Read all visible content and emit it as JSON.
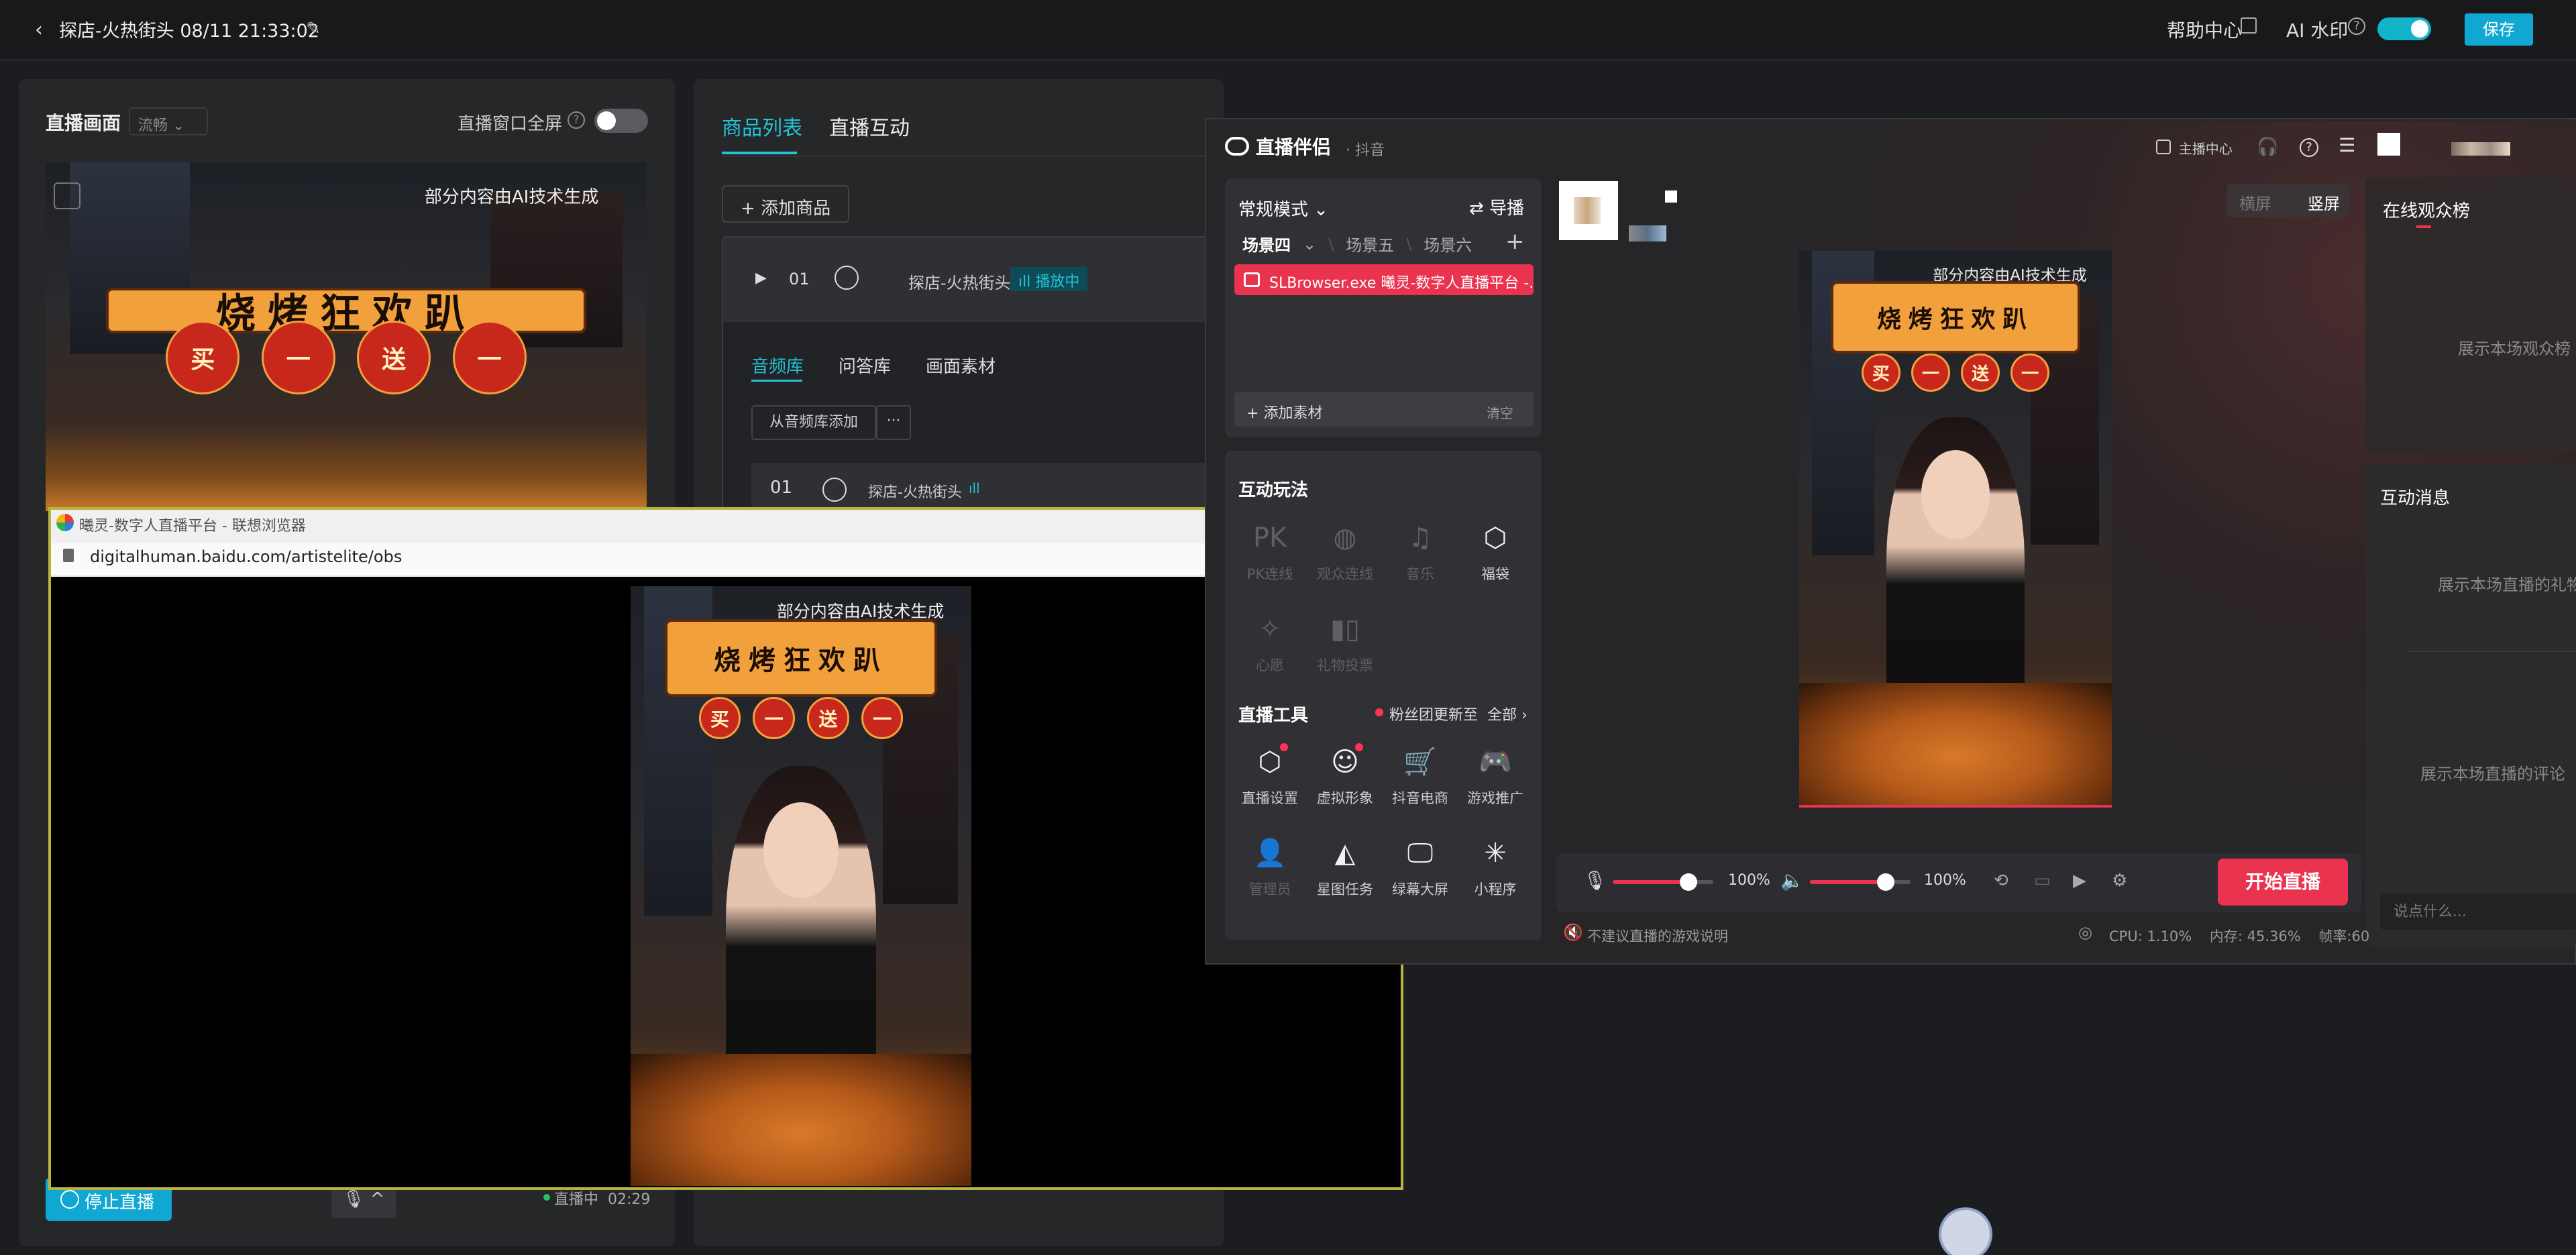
{
  "topbar": {
    "title": "探店-火热街头 08/11 21:33:02",
    "help": "帮助中心",
    "ai_watermark": "AI 水印",
    "save": "保存"
  },
  "left_panel": {
    "title": "直播画面",
    "quality": "流畅",
    "fullscreen_label": "直播窗口全屏",
    "stop_button": "停止直播",
    "live_status": "直播中",
    "live_time": "02:29"
  },
  "poster": {
    "ai_note": "部分内容由AI技术生成",
    "headline": "烧烤狂欢趴",
    "sub": [
      "买",
      "一",
      "送",
      "一"
    ]
  },
  "mid_panel": {
    "tabs": [
      "商品列表",
      "直播互动"
    ],
    "add_goods": "添加商品",
    "goods_row": {
      "num": "01",
      "name": "探店-火热街头",
      "status": "播放中"
    },
    "sub_tabs": [
      "音频库",
      "问答库",
      "画面素材"
    ],
    "from_library": "从音频库添加",
    "more": "···",
    "audio_row": {
      "num": "01",
      "name": "探店-火热街头"
    }
  },
  "browser": {
    "title": "曦灵-数字人直播平台 - 联想浏览器",
    "url": "digitalhuman.baidu.com/artistelite/obs"
  },
  "companion": {
    "app_name": "直播伴侣",
    "app_sub": "· 抖音",
    "host_center": "主播中心",
    "mode": "常规模式",
    "guide": "导播",
    "scenes": [
      "场景四",
      "场景五",
      "场景六"
    ],
    "source": "SLBrowser.exe 曦灵-数字人直播平台 -...",
    "add_material": "添加素材",
    "clear": "清空",
    "interact_title": "互动玩法",
    "interact_tools": [
      {
        "label": "PK连线",
        "icon": "pk-icon",
        "enabled": false
      },
      {
        "label": "观众连线",
        "icon": "audience-link-icon",
        "enabled": false
      },
      {
        "label": "音乐",
        "icon": "music-icon",
        "enabled": false
      },
      {
        "label": "福袋",
        "icon": "lucky-bag-icon",
        "enabled": true
      },
      {
        "label": "心愿",
        "icon": "wish-icon",
        "enabled": false
      },
      {
        "label": "礼物投票",
        "icon": "vote-icon",
        "enabled": false
      }
    ],
    "live_tools_title": "直播工具",
    "fan_update": "粉丝团更新至",
    "all": "全部",
    "live_tools": [
      {
        "label": "直播设置",
        "icon": "settings-icon",
        "enabled": true,
        "dot": true
      },
      {
        "label": "虚拟形象",
        "icon": "avatar-icon",
        "enabled": true,
        "dot": true
      },
      {
        "label": "抖音电商",
        "icon": "cart-icon",
        "enabled": true,
        "dot": false
      },
      {
        "label": "游戏推广",
        "icon": "gamepad-icon",
        "enabled": true,
        "dot": false
      },
      {
        "label": "管理员",
        "icon": "admin-icon",
        "enabled": false,
        "dot": false
      },
      {
        "label": "星图任务",
        "icon": "star-task-icon",
        "enabled": true,
        "dot": false
      },
      {
        "label": "绿幕大屏",
        "icon": "greenscreen-icon",
        "enabled": true,
        "dot": false
      },
      {
        "label": "小程序",
        "icon": "miniapp-icon",
        "enabled": true,
        "dot": false
      }
    ],
    "orient_h": "横屏",
    "orient_v": "竖屏",
    "audience_title": "在线观众榜",
    "audience_empty": "展示本场观众榜",
    "msg_title": "互动消息",
    "gift_empty": "展示本场直播的礼物",
    "comment_empty": "展示本场直播的评论",
    "msg_placeholder": "说点什么...",
    "mic_volume": "100%",
    "mic_level": 0.75,
    "speaker_volume": "100%",
    "speaker_level": 0.75,
    "start_button": "开始直播",
    "game_note": "不建议直播的游戏说明",
    "cpu": "CPU: 1.10%",
    "memory": "内存: 45.36%",
    "fps": "帧率:60"
  },
  "colors": {
    "accent": "#10a7d3",
    "douyin_red": "#e9334f",
    "teal": "#22c3d6"
  }
}
